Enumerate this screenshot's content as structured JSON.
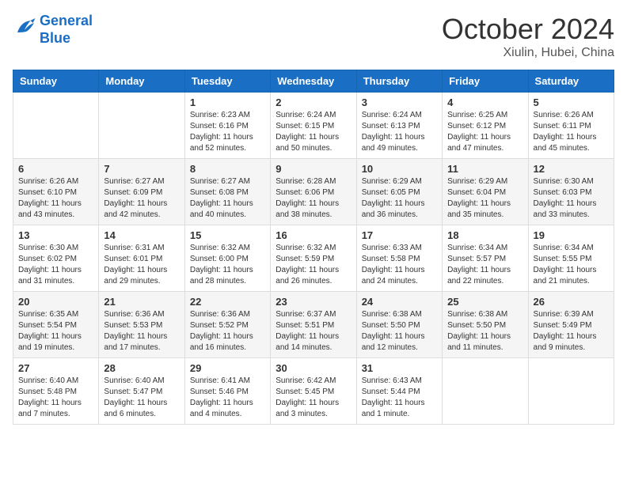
{
  "header": {
    "logo_line1": "General",
    "logo_line2": "Blue",
    "month": "October 2024",
    "location": "Xiulin, Hubei, China"
  },
  "days_of_week": [
    "Sunday",
    "Monday",
    "Tuesday",
    "Wednesday",
    "Thursday",
    "Friday",
    "Saturday"
  ],
  "weeks": [
    [
      {
        "num": "",
        "sunrise": "",
        "sunset": "",
        "daylight": ""
      },
      {
        "num": "",
        "sunrise": "",
        "sunset": "",
        "daylight": ""
      },
      {
        "num": "1",
        "sunrise": "Sunrise: 6:23 AM",
        "sunset": "Sunset: 6:16 PM",
        "daylight": "Daylight: 11 hours and 52 minutes."
      },
      {
        "num": "2",
        "sunrise": "Sunrise: 6:24 AM",
        "sunset": "Sunset: 6:15 PM",
        "daylight": "Daylight: 11 hours and 50 minutes."
      },
      {
        "num": "3",
        "sunrise": "Sunrise: 6:24 AM",
        "sunset": "Sunset: 6:13 PM",
        "daylight": "Daylight: 11 hours and 49 minutes."
      },
      {
        "num": "4",
        "sunrise": "Sunrise: 6:25 AM",
        "sunset": "Sunset: 6:12 PM",
        "daylight": "Daylight: 11 hours and 47 minutes."
      },
      {
        "num": "5",
        "sunrise": "Sunrise: 6:26 AM",
        "sunset": "Sunset: 6:11 PM",
        "daylight": "Daylight: 11 hours and 45 minutes."
      }
    ],
    [
      {
        "num": "6",
        "sunrise": "Sunrise: 6:26 AM",
        "sunset": "Sunset: 6:10 PM",
        "daylight": "Daylight: 11 hours and 43 minutes."
      },
      {
        "num": "7",
        "sunrise": "Sunrise: 6:27 AM",
        "sunset": "Sunset: 6:09 PM",
        "daylight": "Daylight: 11 hours and 42 minutes."
      },
      {
        "num": "8",
        "sunrise": "Sunrise: 6:27 AM",
        "sunset": "Sunset: 6:08 PM",
        "daylight": "Daylight: 11 hours and 40 minutes."
      },
      {
        "num": "9",
        "sunrise": "Sunrise: 6:28 AM",
        "sunset": "Sunset: 6:06 PM",
        "daylight": "Daylight: 11 hours and 38 minutes."
      },
      {
        "num": "10",
        "sunrise": "Sunrise: 6:29 AM",
        "sunset": "Sunset: 6:05 PM",
        "daylight": "Daylight: 11 hours and 36 minutes."
      },
      {
        "num": "11",
        "sunrise": "Sunrise: 6:29 AM",
        "sunset": "Sunset: 6:04 PM",
        "daylight": "Daylight: 11 hours and 35 minutes."
      },
      {
        "num": "12",
        "sunrise": "Sunrise: 6:30 AM",
        "sunset": "Sunset: 6:03 PM",
        "daylight": "Daylight: 11 hours and 33 minutes."
      }
    ],
    [
      {
        "num": "13",
        "sunrise": "Sunrise: 6:30 AM",
        "sunset": "Sunset: 6:02 PM",
        "daylight": "Daylight: 11 hours and 31 minutes."
      },
      {
        "num": "14",
        "sunrise": "Sunrise: 6:31 AM",
        "sunset": "Sunset: 6:01 PM",
        "daylight": "Daylight: 11 hours and 29 minutes."
      },
      {
        "num": "15",
        "sunrise": "Sunrise: 6:32 AM",
        "sunset": "Sunset: 6:00 PM",
        "daylight": "Daylight: 11 hours and 28 minutes."
      },
      {
        "num": "16",
        "sunrise": "Sunrise: 6:32 AM",
        "sunset": "Sunset: 5:59 PM",
        "daylight": "Daylight: 11 hours and 26 minutes."
      },
      {
        "num": "17",
        "sunrise": "Sunrise: 6:33 AM",
        "sunset": "Sunset: 5:58 PM",
        "daylight": "Daylight: 11 hours and 24 minutes."
      },
      {
        "num": "18",
        "sunrise": "Sunrise: 6:34 AM",
        "sunset": "Sunset: 5:57 PM",
        "daylight": "Daylight: 11 hours and 22 minutes."
      },
      {
        "num": "19",
        "sunrise": "Sunrise: 6:34 AM",
        "sunset": "Sunset: 5:55 PM",
        "daylight": "Daylight: 11 hours and 21 minutes."
      }
    ],
    [
      {
        "num": "20",
        "sunrise": "Sunrise: 6:35 AM",
        "sunset": "Sunset: 5:54 PM",
        "daylight": "Daylight: 11 hours and 19 minutes."
      },
      {
        "num": "21",
        "sunrise": "Sunrise: 6:36 AM",
        "sunset": "Sunset: 5:53 PM",
        "daylight": "Daylight: 11 hours and 17 minutes."
      },
      {
        "num": "22",
        "sunrise": "Sunrise: 6:36 AM",
        "sunset": "Sunset: 5:52 PM",
        "daylight": "Daylight: 11 hours and 16 minutes."
      },
      {
        "num": "23",
        "sunrise": "Sunrise: 6:37 AM",
        "sunset": "Sunset: 5:51 PM",
        "daylight": "Daylight: 11 hours and 14 minutes."
      },
      {
        "num": "24",
        "sunrise": "Sunrise: 6:38 AM",
        "sunset": "Sunset: 5:50 PM",
        "daylight": "Daylight: 11 hours and 12 minutes."
      },
      {
        "num": "25",
        "sunrise": "Sunrise: 6:38 AM",
        "sunset": "Sunset: 5:50 PM",
        "daylight": "Daylight: 11 hours and 11 minutes."
      },
      {
        "num": "26",
        "sunrise": "Sunrise: 6:39 AM",
        "sunset": "Sunset: 5:49 PM",
        "daylight": "Daylight: 11 hours and 9 minutes."
      }
    ],
    [
      {
        "num": "27",
        "sunrise": "Sunrise: 6:40 AM",
        "sunset": "Sunset: 5:48 PM",
        "daylight": "Daylight: 11 hours and 7 minutes."
      },
      {
        "num": "28",
        "sunrise": "Sunrise: 6:40 AM",
        "sunset": "Sunset: 5:47 PM",
        "daylight": "Daylight: 11 hours and 6 minutes."
      },
      {
        "num": "29",
        "sunrise": "Sunrise: 6:41 AM",
        "sunset": "Sunset: 5:46 PM",
        "daylight": "Daylight: 11 hours and 4 minutes."
      },
      {
        "num": "30",
        "sunrise": "Sunrise: 6:42 AM",
        "sunset": "Sunset: 5:45 PM",
        "daylight": "Daylight: 11 hours and 3 minutes."
      },
      {
        "num": "31",
        "sunrise": "Sunrise: 6:43 AM",
        "sunset": "Sunset: 5:44 PM",
        "daylight": "Daylight: 11 hours and 1 minute."
      },
      {
        "num": "",
        "sunrise": "",
        "sunset": "",
        "daylight": ""
      },
      {
        "num": "",
        "sunrise": "",
        "sunset": "",
        "daylight": ""
      }
    ]
  ]
}
